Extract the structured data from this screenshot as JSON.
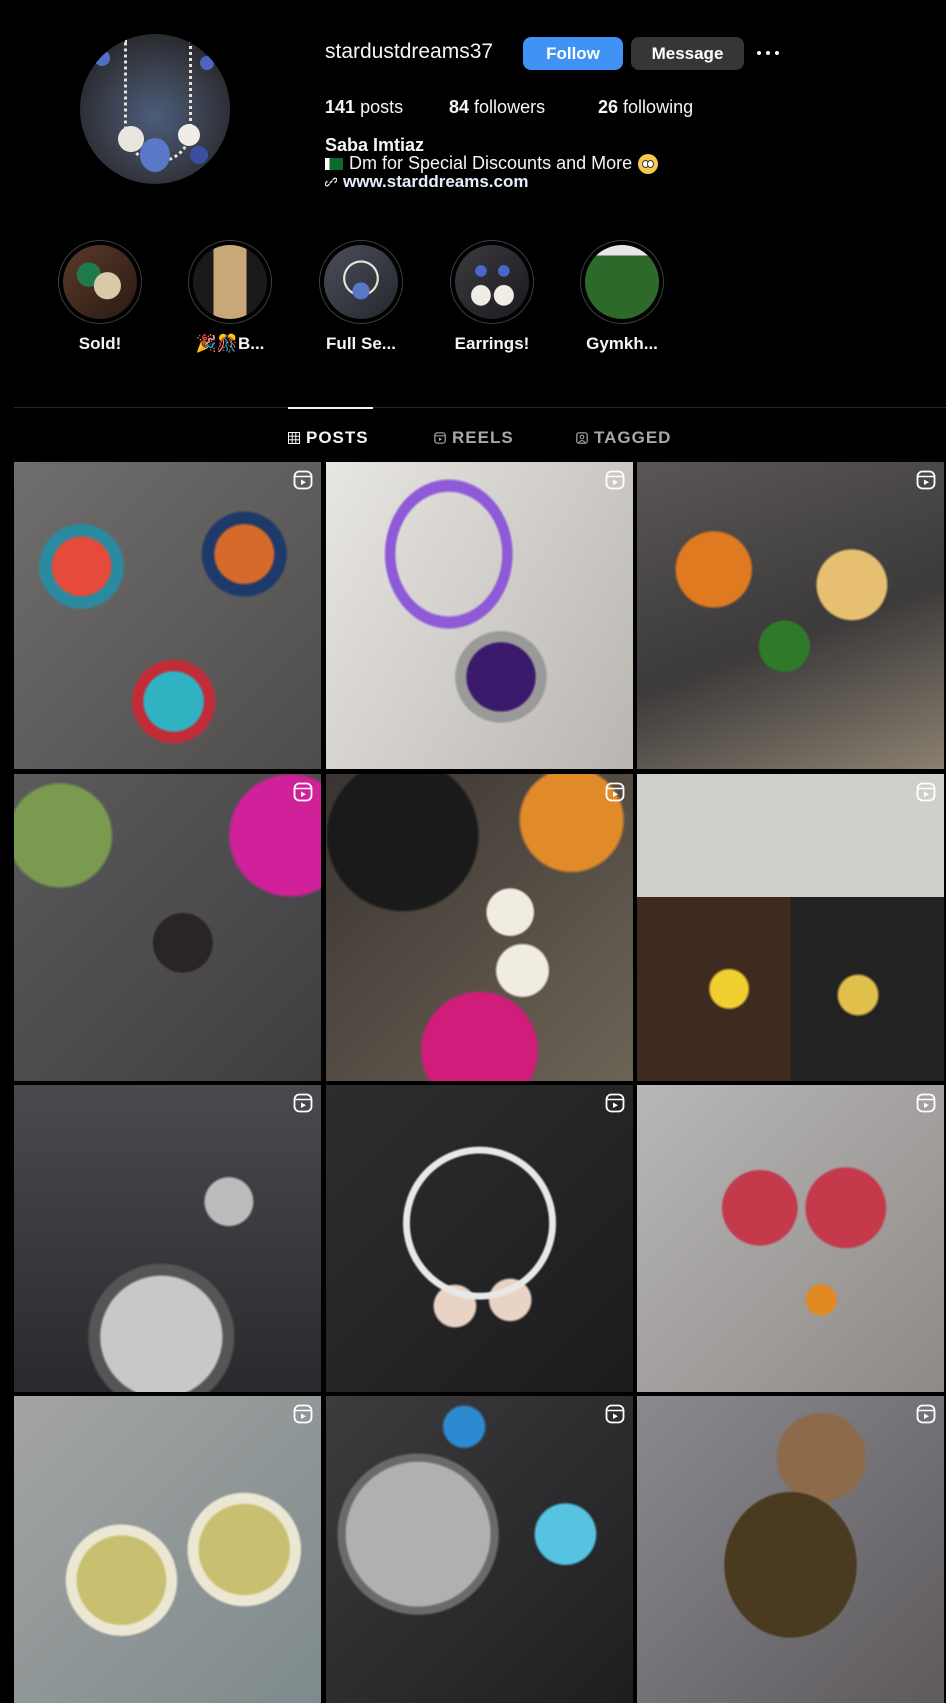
{
  "profile": {
    "username": "stardustdreams37",
    "follow_label": "Follow",
    "message_label": "Message",
    "posts_count": "141",
    "posts_label": "posts",
    "followers_count": "84",
    "followers_label": "followers",
    "following_count": "26",
    "following_label": "following",
    "full_name": "Saba Imtiaz",
    "bio": "Dm for Special Discounts and More",
    "website": "www.starddreams.com"
  },
  "highlights": [
    {
      "label": "Sold!"
    },
    {
      "label": "🎉🎊B..."
    },
    {
      "label": "Full Se..."
    },
    {
      "label": "Earrings!"
    },
    {
      "label": "Gymkh..."
    }
  ],
  "tabs": {
    "posts": "POSTS",
    "reels": "REELS",
    "tagged": "TAGGED"
  },
  "colors": {
    "background": "#000000",
    "follow_button": "#4093f5",
    "message_button": "#363636",
    "text": "#f5f5f5",
    "muted": "#a8a8a8"
  },
  "posts": [
    {
      "type": "reel"
    },
    {
      "type": "reel"
    },
    {
      "type": "reel"
    },
    {
      "type": "reel"
    },
    {
      "type": "reel"
    },
    {
      "type": "reel"
    },
    {
      "type": "reel"
    },
    {
      "type": "reel"
    },
    {
      "type": "reel"
    },
    {
      "type": "reel"
    },
    {
      "type": "reel"
    },
    {
      "type": "reel"
    }
  ]
}
